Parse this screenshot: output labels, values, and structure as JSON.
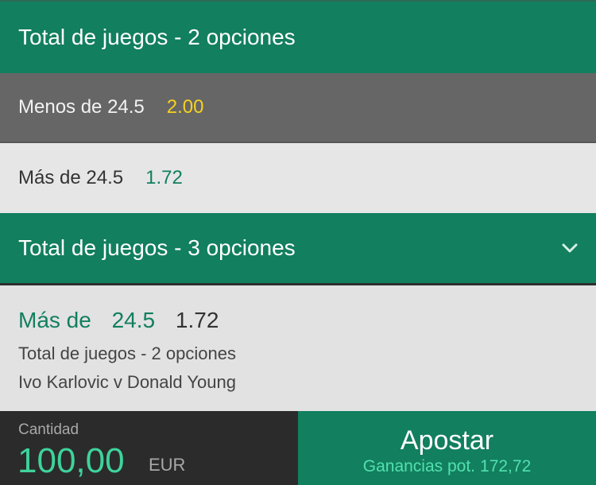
{
  "markets": [
    {
      "title": "Total de juegos - 2 opciones",
      "options": [
        {
          "label": "Menos de 24.5",
          "odds": "2.00",
          "selected": true
        },
        {
          "label": "Más de 24.5",
          "odds": "1.72",
          "selected": false
        }
      ]
    },
    {
      "title": "Total de juegos - 3 opciones",
      "icon": "chevron-down-icon"
    }
  ],
  "betslip": {
    "selection_label": "Más de",
    "selection_line": "24.5",
    "odds": "1.72",
    "market": "Total de juegos - 2 opciones",
    "event": "Ivo Karlovic v Donald Young"
  },
  "footer": {
    "stake_label": "Cantidad",
    "stake_amount": "100,00",
    "currency": "EUR",
    "bet_button_label": "Apostar",
    "potential_label": "Ganancias pot.",
    "potential_value": "172,72"
  },
  "colors": {
    "brand_green": "#127f5f",
    "selected_odds_yellow": "#f7d11e",
    "stake_green": "#3ed39c"
  }
}
